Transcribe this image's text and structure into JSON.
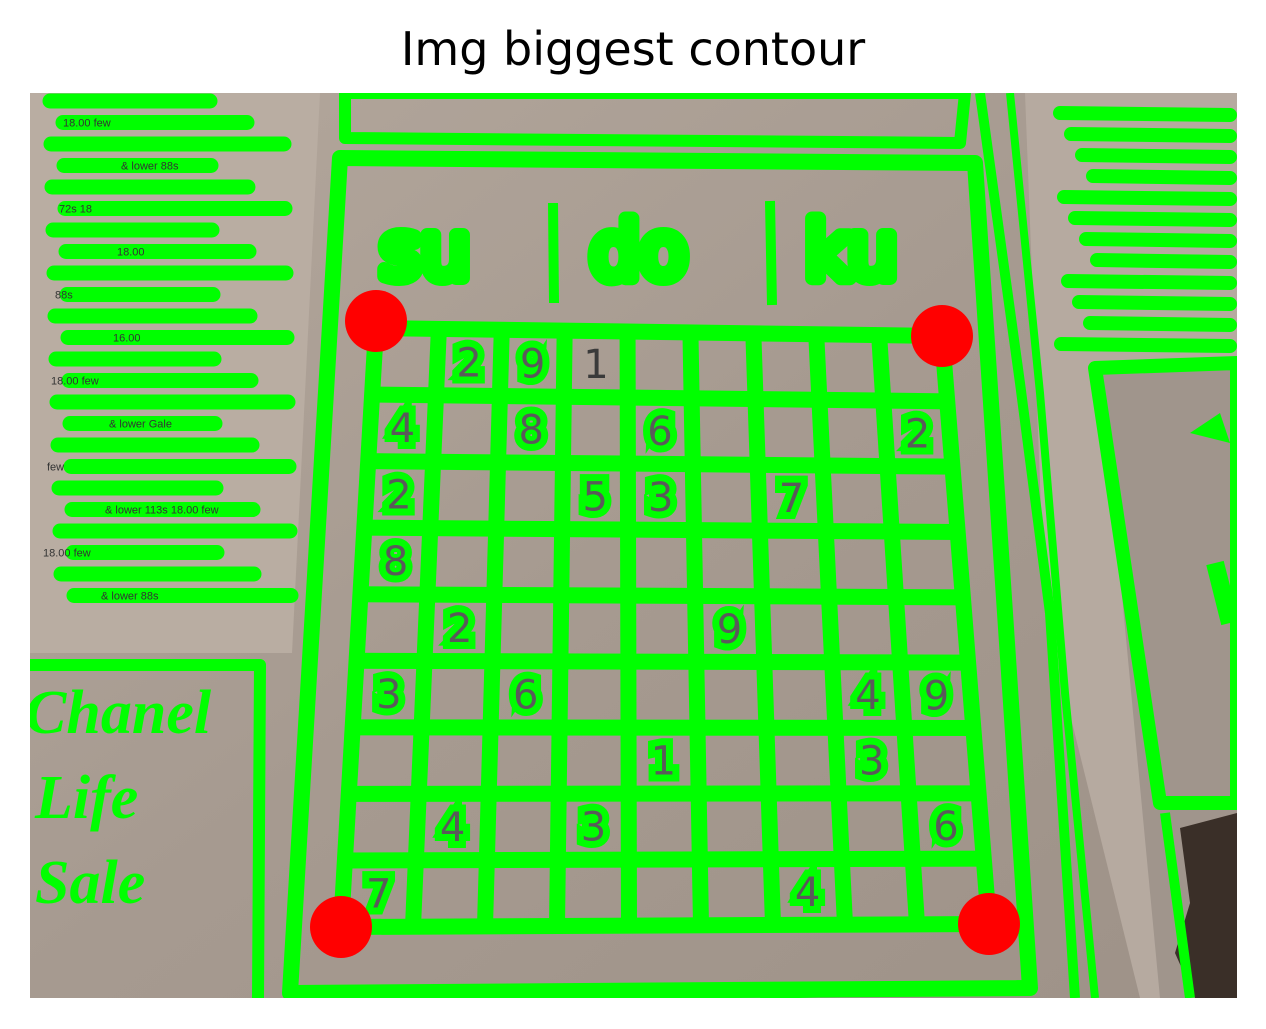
{
  "figure": {
    "title": "Img biggest contour"
  },
  "image": {
    "heading_parts": [
      "su",
      "do",
      "ku"
    ],
    "grid_digits": [
      {
        "row": 0,
        "col": 1,
        "text": "2"
      },
      {
        "row": 0,
        "col": 2,
        "text": "9"
      },
      {
        "row": 0,
        "col": 3,
        "text": "1",
        "highlighted": false
      },
      {
        "row": 1,
        "col": 0,
        "text": "4"
      },
      {
        "row": 1,
        "col": 2,
        "text": "8"
      },
      {
        "row": 1,
        "col": 4,
        "text": "6"
      },
      {
        "row": 1,
        "col": 8,
        "text": "2"
      },
      {
        "row": 2,
        "col": 0,
        "text": "2"
      },
      {
        "row": 2,
        "col": 3,
        "text": "5"
      },
      {
        "row": 2,
        "col": 4,
        "text": "3"
      },
      {
        "row": 2,
        "col": 6,
        "text": "7"
      },
      {
        "row": 3,
        "col": 0,
        "text": "8"
      },
      {
        "row": 4,
        "col": 1,
        "text": "2"
      },
      {
        "row": 4,
        "col": 5,
        "text": "9"
      },
      {
        "row": 5,
        "col": 0,
        "text": "3"
      },
      {
        "row": 5,
        "col": 2,
        "text": "6"
      },
      {
        "row": 5,
        "col": 7,
        "text": "4"
      },
      {
        "row": 5,
        "col": 8,
        "text": "9"
      },
      {
        "row": 6,
        "col": 4,
        "text": "1"
      },
      {
        "row": 6,
        "col": 7,
        "text": "3"
      },
      {
        "row": 7,
        "col": 1,
        "text": "4"
      },
      {
        "row": 7,
        "col": 3,
        "text": "3"
      },
      {
        "row": 7,
        "col": 8,
        "text": "6"
      },
      {
        "row": 8,
        "col": 0,
        "text": "7"
      },
      {
        "row": 8,
        "col": 6,
        "text": "4"
      }
    ],
    "newsprint_fragments": [
      "18.00 few",
      "& lower 88s",
      "72s 18",
      "18.00",
      "88s",
      "16.00",
      "18.00 few",
      "& lower Gale",
      "few",
      "& lower 113s 18.00 few"
    ],
    "banner_words": [
      "Chanel",
      "Life",
      "Sale"
    ],
    "contour_color": "#00ff00",
    "corner_color": "#ff0000"
  }
}
